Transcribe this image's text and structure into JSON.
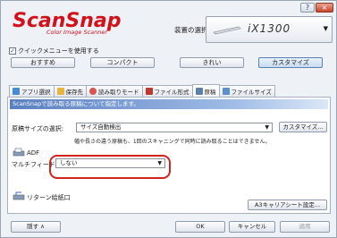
{
  "window": {
    "controls": [
      "?",
      "×"
    ]
  },
  "header": {
    "logo_text": "ScanSnap",
    "logo_sub": "Color Image Scanner",
    "device_label": "装置の選択",
    "device_name": "iX1300",
    "quick_menu_label": "クイックメニューを使用する",
    "quick_menu_checked": true
  },
  "modes": [
    {
      "label": "おすすめ",
      "active": false
    },
    {
      "label": "コンパクト",
      "active": false
    },
    {
      "label": "きれい",
      "active": false
    },
    {
      "label": "カスタマイズ",
      "active": true
    }
  ],
  "tabs": [
    {
      "label": "アプリ選択",
      "icon": "app-icon",
      "color": "#4a8ad4",
      "active": false
    },
    {
      "label": "保存先",
      "icon": "folder-icon",
      "color": "#e6b53b",
      "active": false
    },
    {
      "label": "読み取りモード",
      "icon": "scan-mode-icon",
      "color": "#d9534f",
      "active": false
    },
    {
      "label": "ファイル形式",
      "icon": "file-format-icon",
      "color": "#c0392b",
      "active": false
    },
    {
      "label": "原稿",
      "icon": "document-icon",
      "color": "#5d7fae",
      "active": true
    },
    {
      "label": "ファイルサイズ",
      "icon": "file-size-icon",
      "color": "#5a8fd0",
      "active": false
    }
  ],
  "panel": {
    "banner": "ScanSnapで読み取る原稿について指定します。",
    "paper_size_label": "原稿サイズの選択:",
    "paper_size_value": "サイズ自動検出",
    "customize_button": "カスタマイズ...",
    "paper_note": "幅や長さの違う原稿も、1回のスキャニングで同時に読み取ることはできません。",
    "adf_label": "ADF",
    "multifeed_label": "マルチフィード検出:",
    "multifeed_value": "しない",
    "return_label": "リターン給紙口",
    "carrier_button": "A3キャリアシート設定..."
  },
  "footer": {
    "hide_button": "隠す",
    "ok_button": "OK",
    "cancel_button": "キャンセル",
    "apply_button": "適用"
  }
}
